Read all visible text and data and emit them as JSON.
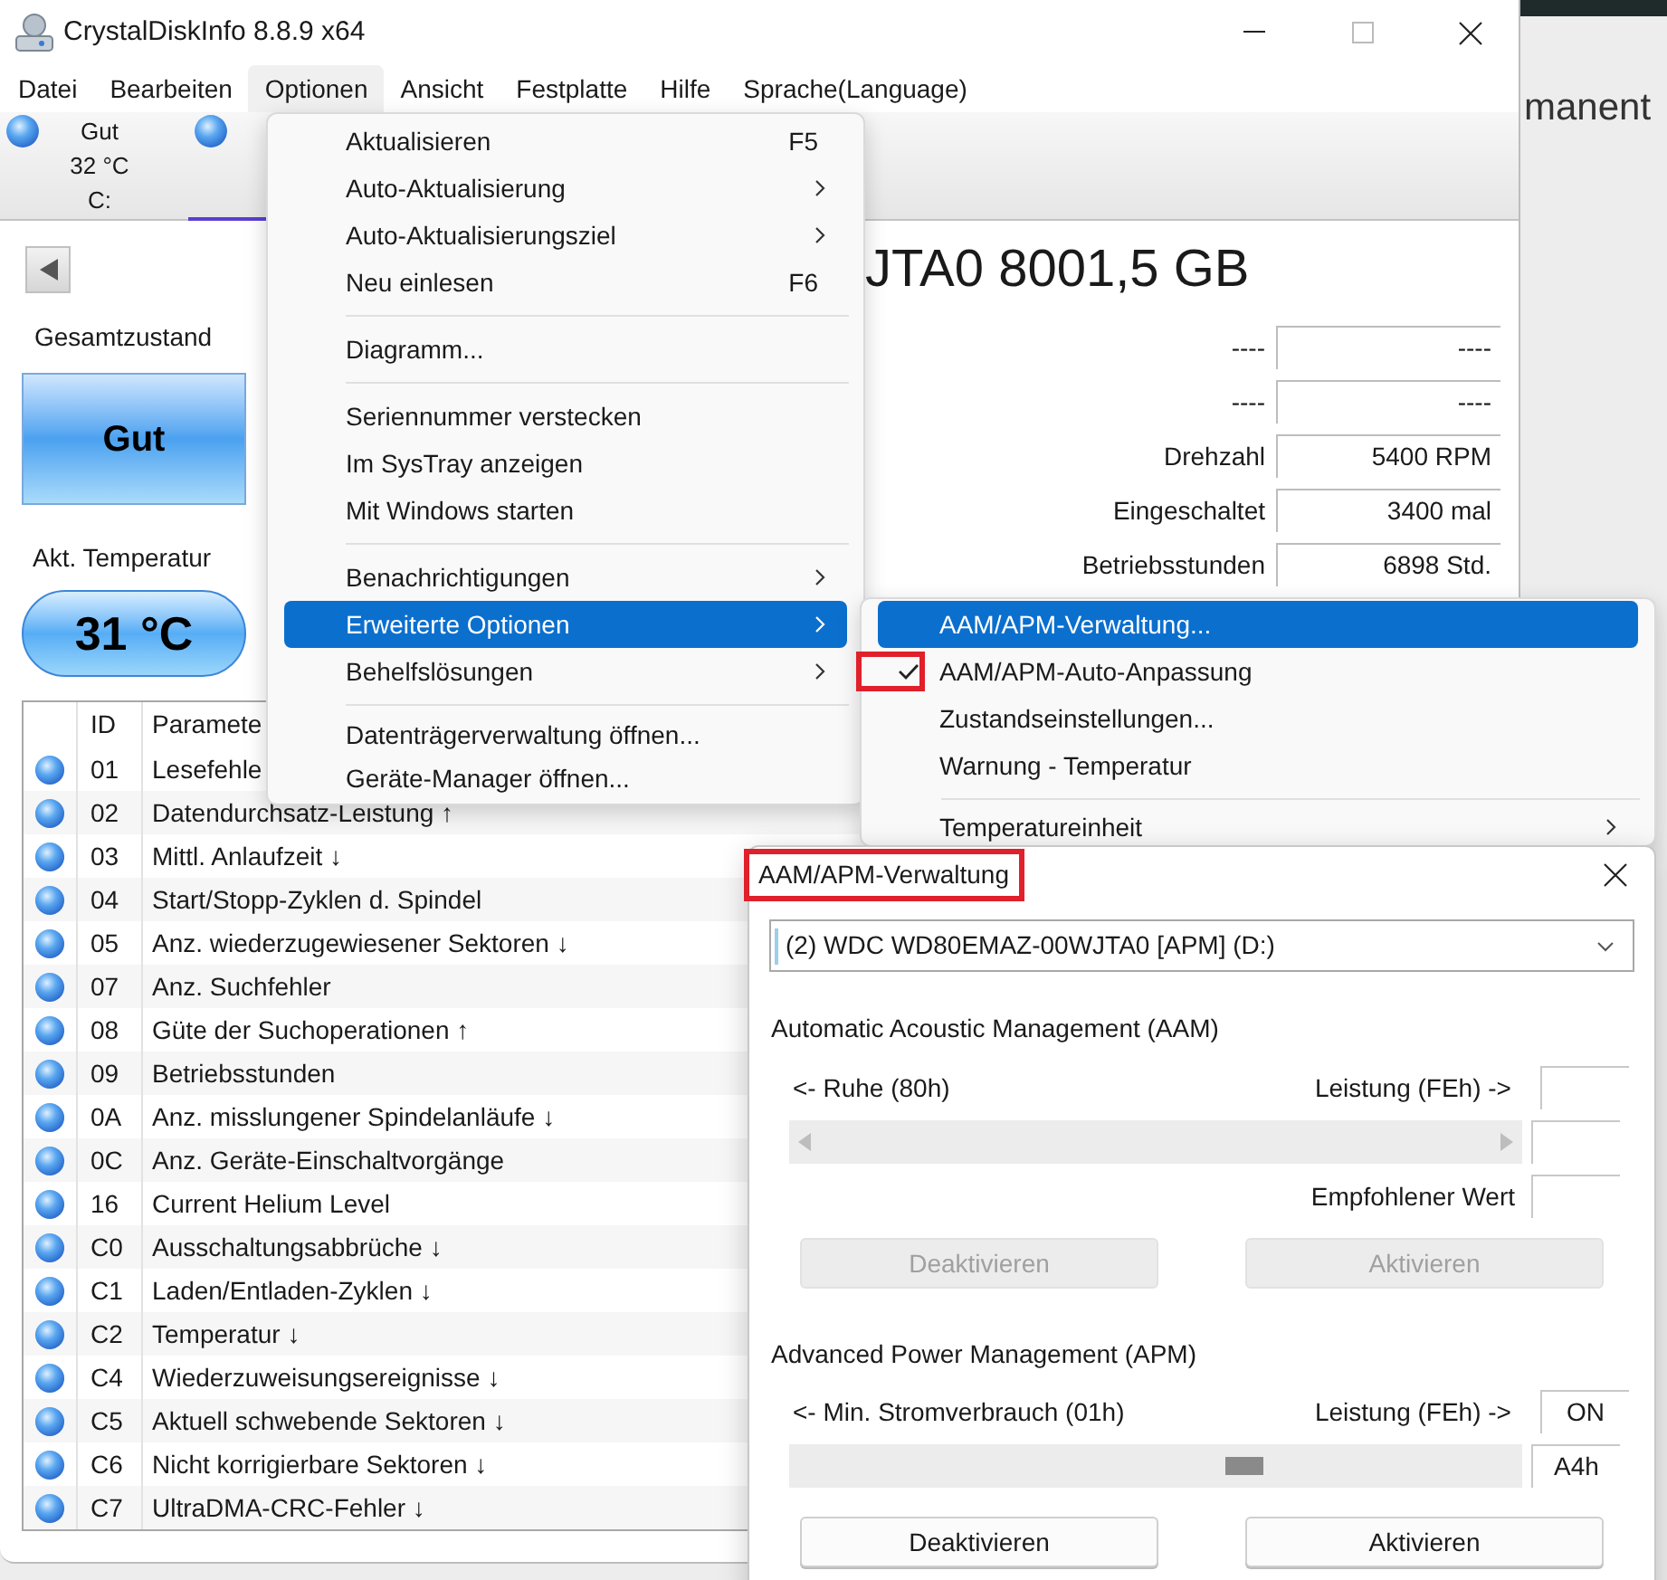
{
  "window": {
    "title": "CrystalDiskInfo 8.8.9 x64"
  },
  "menu_bar": [
    {
      "label": "Datei",
      "selected": false
    },
    {
      "label": "Bearbeiten",
      "selected": false
    },
    {
      "label": "Optionen",
      "selected": true
    },
    {
      "label": "Ansicht",
      "selected": false
    },
    {
      "label": "Festplatte",
      "selected": false
    },
    {
      "label": "Hilfe",
      "selected": false
    },
    {
      "label": "Sprache(Language)",
      "selected": false
    }
  ],
  "disks": [
    {
      "status": "Gut",
      "temperature": "32 °C",
      "drive": "C:",
      "selected": false
    },
    {
      "selected": true
    }
  ],
  "health": {
    "label": "Gesamtzustand",
    "status": "Gut"
  },
  "temperature": {
    "label": "Akt. Temperatur",
    "value": "31 °C"
  },
  "model_title": "JTA0 8001,5 GB",
  "info_rows": [
    {
      "label": "----",
      "value": "----"
    },
    {
      "label": "----",
      "value": "----"
    },
    {
      "label": "Drehzahl",
      "value": "5400 RPM"
    },
    {
      "label": "Eingeschaltet",
      "value": "3400 mal"
    },
    {
      "label": "Betriebsstunden",
      "value": "6898 Std."
    }
  ],
  "smart_table": {
    "columns": [
      "ID",
      "Paramete"
    ],
    "rows": [
      {
        "id": "01",
        "name": "Lesefehle"
      },
      {
        "id": "02",
        "name": "Datendurchsatz-Leistung ↑"
      },
      {
        "id": "03",
        "name": "Mittl. Anlaufzeit ↓"
      },
      {
        "id": "04",
        "name": "Start/Stopp-Zyklen d. Spindel"
      },
      {
        "id": "05",
        "name": "Anz. wiederzugewiesener Sektoren ↓"
      },
      {
        "id": "07",
        "name": "Anz. Suchfehler"
      },
      {
        "id": "08",
        "name": "Güte der Suchoperationen ↑"
      },
      {
        "id": "09",
        "name": "Betriebsstunden"
      },
      {
        "id": "0A",
        "name": "Anz. misslungener Spindelanläufe ↓"
      },
      {
        "id": "0C",
        "name": "Anz. Geräte-Einschaltvorgänge"
      },
      {
        "id": "16",
        "name": "Current Helium Level"
      },
      {
        "id": "C0",
        "name": "Ausschaltungsabbrüche ↓"
      },
      {
        "id": "C1",
        "name": "Laden/Entladen-Zyklen ↓"
      },
      {
        "id": "C2",
        "name": "Temperatur ↓"
      },
      {
        "id": "C4",
        "name": "Wiederzuweisungsereignisse ↓"
      },
      {
        "id": "C5",
        "name": "Aktuell schwebende Sektoren ↓"
      },
      {
        "id": "C6",
        "name": "Nicht korrigierbare Sektoren ↓"
      },
      {
        "id": "C7",
        "name": "UltraDMA-CRC-Fehler ↓"
      }
    ]
  },
  "options_menu": {
    "items": [
      {
        "kind": "item",
        "label": "Aktualisieren",
        "shortcut": "F5",
        "submenu": false,
        "selected": false
      },
      {
        "kind": "item",
        "label": "Auto-Aktualisierung",
        "submenu": true,
        "selected": false
      },
      {
        "kind": "item",
        "label": "Auto-Aktualisierungsziel",
        "submenu": true,
        "selected": false
      },
      {
        "kind": "item",
        "label": "Neu einlesen",
        "shortcut": "F6",
        "submenu": false,
        "selected": false
      },
      {
        "kind": "separator"
      },
      {
        "kind": "item",
        "label": "Diagramm...",
        "submenu": false,
        "selected": false
      },
      {
        "kind": "separator"
      },
      {
        "kind": "item",
        "label": "Seriennummer verstecken",
        "submenu": false,
        "selected": false
      },
      {
        "kind": "item",
        "label": "Im SysTray anzeigen",
        "submenu": false,
        "selected": false
      },
      {
        "kind": "item",
        "label": "Mit Windows starten",
        "submenu": false,
        "selected": false
      },
      {
        "kind": "separator"
      },
      {
        "kind": "item",
        "label": "Benachrichtigungen",
        "submenu": true,
        "selected": false
      },
      {
        "kind": "item",
        "label": "Erweiterte Optionen",
        "submenu": true,
        "selected": true
      },
      {
        "kind": "item",
        "label": "Behelfslösungen",
        "submenu": true,
        "selected": false
      },
      {
        "kind": "separator"
      },
      {
        "kind": "item",
        "label": "Datenträgerverwaltung öffnen...",
        "submenu": false,
        "selected": false
      },
      {
        "kind": "item",
        "label": "Geräte-Manager öffnen...",
        "submenu": false,
        "selected": false
      }
    ]
  },
  "advanced_submenu": {
    "items": [
      {
        "kind": "item",
        "label": "AAM/APM-Verwaltung...",
        "checked": false,
        "submenu": false,
        "selected": true
      },
      {
        "kind": "item",
        "label": "AAM/APM-Auto-Anpassung",
        "checked": true,
        "submenu": false,
        "selected": false
      },
      {
        "kind": "item",
        "label": "Zustandseinstellungen...",
        "checked": false,
        "submenu": false,
        "selected": false
      },
      {
        "kind": "item",
        "label": "Warnung - Temperatur",
        "checked": false,
        "submenu": false,
        "selected": false
      },
      {
        "kind": "separator"
      },
      {
        "kind": "item",
        "label": "Temperatureinheit",
        "checked": false,
        "submenu": true,
        "selected": false
      }
    ]
  },
  "dialog": {
    "title": "AAM/APM-Verwaltung",
    "drive": "(2) WDC WD80EMAZ-00WJTA0 [APM] (D:)",
    "sections": [
      {
        "title": "Automatic Acoustic Management (AAM)",
        "min_label": "<- Ruhe (80h)",
        "max_label": "Leistung (FEh) ->",
        "recommended_label": "Empfohlener Wert",
        "disabled": true,
        "buttons": [
          "Deaktivieren",
          "Aktivieren"
        ]
      },
      {
        "title": "Advanced Power Management (APM)",
        "min_label": "<- Min. Stromverbrauch (01h)",
        "max_label": "Leistung (FEh) ->",
        "status": "ON",
        "value": "A4h",
        "level": 0.62,
        "disabled": false,
        "buttons": [
          "Deaktivieren",
          "Aktivieren"
        ]
      }
    ]
  },
  "background_text": "manent"
}
